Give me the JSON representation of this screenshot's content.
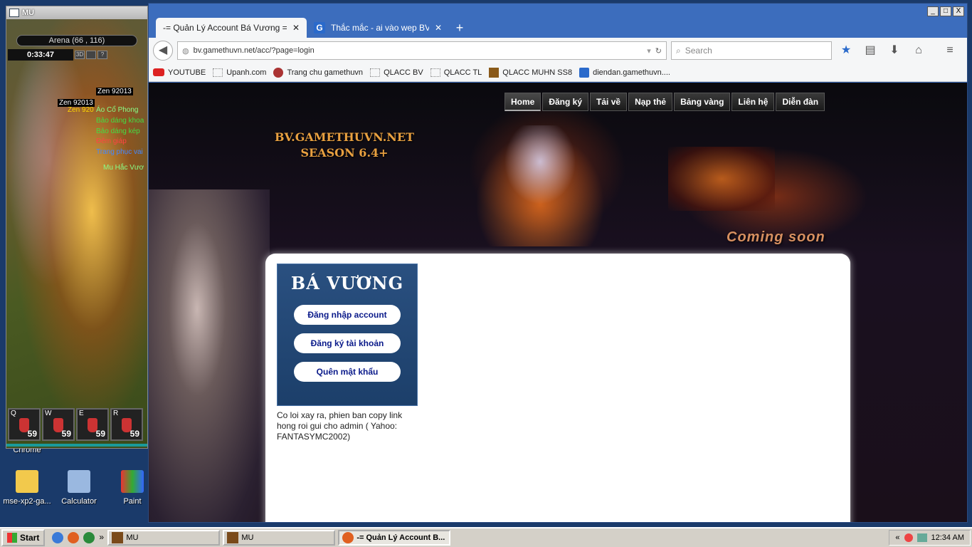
{
  "desktop": {
    "icons": [
      {
        "label": "mse-xp2-ga..."
      },
      {
        "label": "Calculator"
      },
      {
        "label": "Paint"
      }
    ],
    "partial_label": "Chrome"
  },
  "game": {
    "title": "MU",
    "arena": "Arena (66 , 116)",
    "timer": "0:33:47",
    "buttons": [
      "3D",
      "",
      "?"
    ],
    "chat": [
      {
        "text": "Zen 92013",
        "color": "#ffffff"
      },
      {
        "text": "Zen 92013",
        "color": "#ffffff"
      },
      {
        "text": "Zen 920",
        "color": "#ffd700"
      },
      {
        "text": "Áo Cổ Phong",
        "color": "#88ff88"
      },
      {
        "text": "Bảo dáng khoa",
        "color": "#44dd44"
      },
      {
        "text": "Bảo dáng kép",
        "color": "#44dd44"
      },
      {
        "text": "Đêm giáp",
        "color": "#ff4444"
      },
      {
        "text": "Trang phục vai",
        "color": "#4488ff"
      },
      {
        "text": "Mu Hắc Vươ",
        "color": "#88ff88"
      }
    ],
    "hotbar": [
      {
        "key": "Q",
        "count": "59"
      },
      {
        "key": "W",
        "count": "59"
      },
      {
        "key": "E",
        "count": "59"
      },
      {
        "key": "R",
        "count": "59"
      }
    ]
  },
  "browser": {
    "tabs": [
      {
        "title": "-= Quản Lý Account Bá Vương =- ...",
        "active": true
      },
      {
        "title": "Thắc mắc - ai vào wep BV bị n...",
        "active": false
      }
    ],
    "window_controls": [
      "_",
      "□",
      "X"
    ],
    "url": "bv.gamethuvn.net/acc/?page=login",
    "search_placeholder": "Search",
    "bookmarks": [
      {
        "label": "YOUTUBE",
        "icon": "youtube-icon"
      },
      {
        "label": "Upanh.com",
        "icon": "page-icon"
      },
      {
        "label": "Trang chu gamethuvn",
        "icon": "site-icon"
      },
      {
        "label": "QLACC BV",
        "icon": "page-icon"
      },
      {
        "label": "QLACC TL",
        "icon": "page-icon"
      },
      {
        "label": "QLACC MUHN SS8",
        "icon": "mu-icon"
      },
      {
        "label": "diendan.gamethuvn....",
        "icon": "g-icon"
      }
    ]
  },
  "site": {
    "menu": [
      "Home",
      "Đăng ký",
      "Tải về",
      "Nạp thẻ",
      "Bảng vàng",
      "Liên hệ",
      "Diễn đàn"
    ],
    "logo_line1": "BV.GAMETHUVN.NET",
    "logo_line2": "SEASON 6.4+",
    "coming_soon": "Coming soon",
    "box_title": "BÁ VƯƠNG",
    "box_buttons": [
      "Đăng nhập account",
      "Đăng ký tài khoản",
      "Quên mật khẩu"
    ],
    "error": "Co loi xay ra, phien ban copy link hong roi gui cho admin ( Yahoo: FANTASYMC2002)"
  },
  "taskbar": {
    "start": "Start",
    "items": [
      {
        "label": "MU",
        "active": false
      },
      {
        "label": "MU",
        "active": false
      },
      {
        "label": "-= Quản Lý Account B...",
        "active": true
      }
    ],
    "clock": "12:34 AM",
    "tray_chevron": "«"
  }
}
